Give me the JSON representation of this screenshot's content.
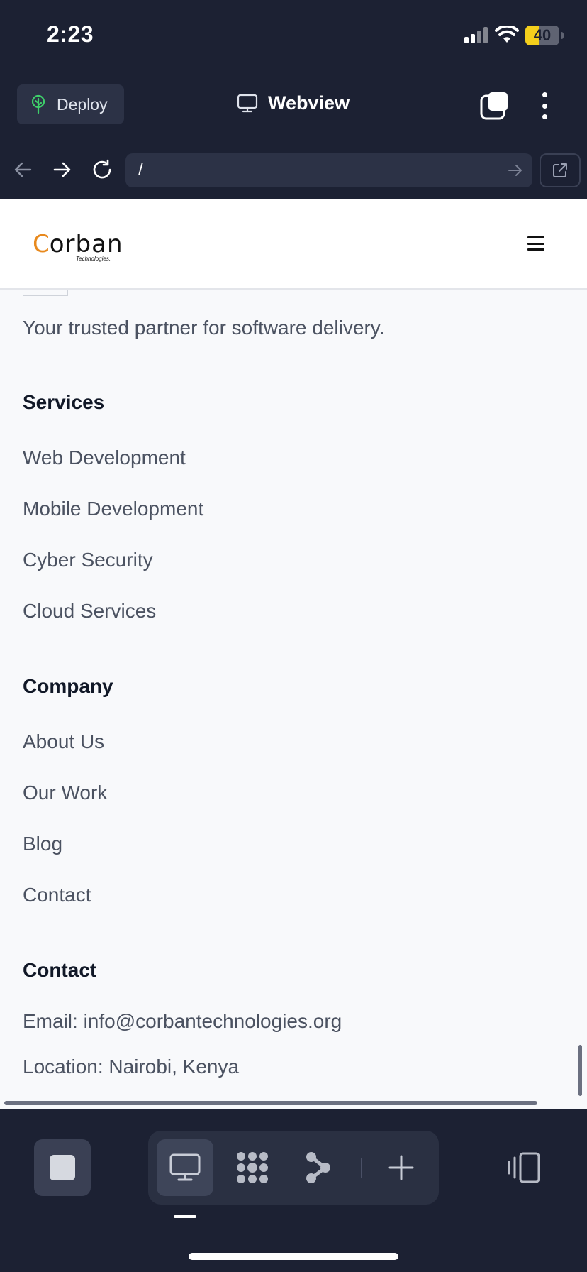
{
  "status_bar": {
    "time": "2:23",
    "battery": "40",
    "battery_level": 0.4
  },
  "app_header": {
    "deploy_label": "Deploy",
    "tab_title": "Webview"
  },
  "url_bar": {
    "url": "/"
  },
  "site": {
    "logo": {
      "first_letter": "C",
      "rest": "orban",
      "sub": "Technologies."
    },
    "tagline": "Your trusted partner for software delivery.",
    "services": {
      "title": "Services",
      "links": [
        "Web Development",
        "Mobile Development",
        "Cyber Security",
        "Cloud Services"
      ]
    },
    "company": {
      "title": "Company",
      "links": [
        "About Us",
        "Our Work",
        "Blog",
        "Contact"
      ]
    },
    "contact": {
      "title": "Contact",
      "email": "Email: info@corbantechnologies.org",
      "location": "Location: Nairobi, Kenya"
    }
  },
  "colors": {
    "app_bg": "#1c2133",
    "page_bg": "#f8f9fb",
    "brand_orange": "#e8891d",
    "battery_yellow": "#f4cf1c"
  }
}
